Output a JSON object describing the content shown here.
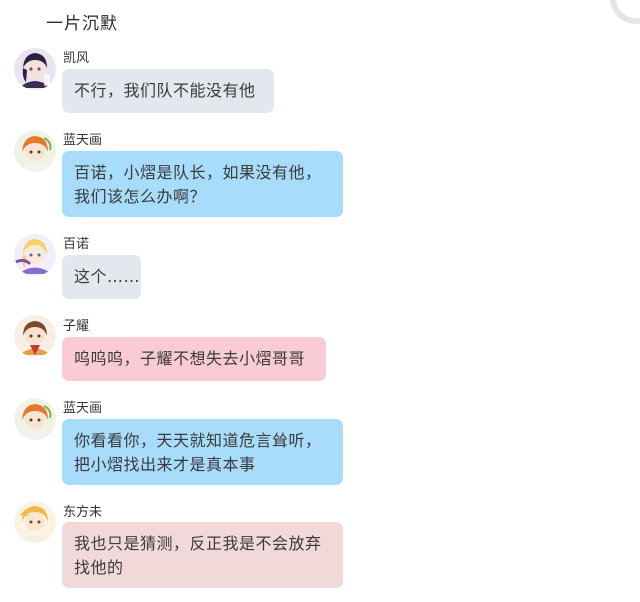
{
  "narration": "一片沉默",
  "messages": [
    {
      "sender": "凯风",
      "avatar": "kaifeng-avatar",
      "lines": [
        "不行，我们队不能没有他"
      ],
      "color": "#e3e7ee"
    },
    {
      "sender": "蓝天画",
      "avatar": "lantianhua-avatar",
      "lines": [
        "百诺，小熠是队长，如果没有他，",
        "我们该怎么办啊？"
      ],
      "color": "#a8dcfb"
    },
    {
      "sender": "百诺",
      "avatar": "bainuo-avatar",
      "lines": [
        "这个……"
      ],
      "color": "#e3e7ee"
    },
    {
      "sender": "子耀",
      "avatar": "ziyao-avatar",
      "lines": [
        "呜呜呜，子耀不想失去小熠哥哥"
      ],
      "color": "#f9cbd5"
    },
    {
      "sender": "蓝天画",
      "avatar": "lantianhua-avatar",
      "lines": [
        "你看看你，天天就知道危言耸听，",
        "把小熠找出来才是真本事"
      ],
      "color": "#a8dcfb"
    },
    {
      "sender": "东方未",
      "avatar": "dongfangwei-avatar",
      "lines": [
        "我也只是猜测，反正我是不会放弃",
        "找他的"
      ],
      "color": "#f1d9da"
    }
  ]
}
